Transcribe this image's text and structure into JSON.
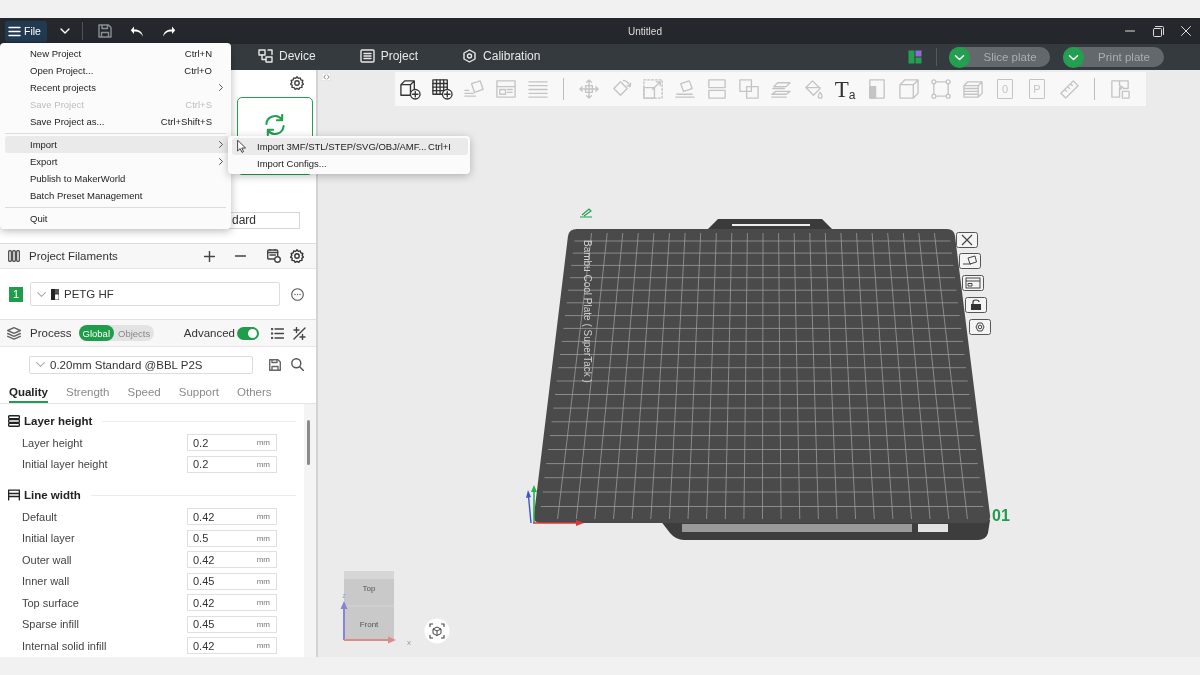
{
  "title_bar": {
    "file_button": {
      "label": "File",
      "active": true
    },
    "title": "Untitled"
  },
  "tabs": [
    {
      "label": "Device",
      "selected": false
    },
    {
      "label": "Project",
      "selected": false
    },
    {
      "label": "Calibration",
      "selected": false
    }
  ],
  "actions": [
    {
      "label": "Slice plate",
      "disabled": true
    },
    {
      "label": "Print plate",
      "disabled": true
    }
  ],
  "file_menu": {
    "groups": [
      {
        "items": [
          {
            "label": "New Project",
            "shortcut": "Ctrl+N",
            "disabled": false,
            "submenu": false,
            "selected": false
          },
          {
            "label": "Open Project...",
            "shortcut": "Ctrl+O",
            "disabled": false,
            "submenu": false,
            "selected": false
          },
          {
            "label": "Recent projects",
            "disabled": false,
            "submenu": true,
            "selected": false
          },
          {
            "label": "Save Project",
            "shortcut": "Ctrl+S",
            "disabled": true,
            "submenu": false,
            "selected": false
          },
          {
            "label": "Save Project as...",
            "shortcut": "Ctrl+Shift+S",
            "disabled": false,
            "submenu": false,
            "selected": false
          }
        ]
      },
      {
        "items": [
          {
            "label": "Import",
            "disabled": false,
            "submenu": true,
            "selected": true
          },
          {
            "label": "Export",
            "disabled": false,
            "submenu": true,
            "selected": false
          },
          {
            "label": "Publish to MakerWorld",
            "disabled": false,
            "submenu": false,
            "selected": false
          },
          {
            "label": "Batch Preset Management",
            "disabled": false,
            "submenu": false,
            "selected": false
          }
        ]
      },
      {
        "items": [
          {
            "label": "Quit",
            "disabled": false,
            "submenu": false,
            "selected": false
          }
        ]
      }
    ]
  },
  "import_submenu": {
    "items": [
      {
        "label": "Import 3MF/STL/STEP/SVG/OBJ/AMF...",
        "shortcut": "Ctrl+I",
        "selected": true
      },
      {
        "label": "Import Configs...",
        "selected": false
      }
    ]
  },
  "side_panel": {
    "printer": {
      "preset": "dard"
    },
    "filaments": {
      "title": "Project Filaments",
      "items": [
        {
          "number": "1",
          "name": "PETG HF",
          "color": "#1f9d4b"
        }
      ]
    },
    "process": {
      "title": "Process",
      "scope": [
        {
          "label": "Global",
          "selected": true
        },
        {
          "label": "Objects",
          "selected": false
        }
      ],
      "advanced": {
        "label": "Advanced",
        "on": true
      },
      "preset": "0.20mm Standard @BBL P2S",
      "tabs": [
        {
          "label": "Quality",
          "selected": true
        },
        {
          "label": "Strength",
          "selected": false
        },
        {
          "label": "Speed",
          "selected": false
        },
        {
          "label": "Support",
          "selected": false
        },
        {
          "label": "Others",
          "selected": false
        }
      ],
      "sections": [
        {
          "kind": "layers",
          "title": "Layer height",
          "rows": [
            {
              "label": "Layer height",
              "value": "0.2",
              "unit": "mm"
            },
            {
              "label": "Initial layer height",
              "value": "0.2",
              "unit": "mm"
            }
          ]
        },
        {
          "kind": "width",
          "title": "Line width",
          "rows": [
            {
              "label": "Default",
              "value": "0.42",
              "unit": "mm"
            },
            {
              "label": "Initial layer",
              "value": "0.5",
              "unit": "mm"
            },
            {
              "label": "Outer wall",
              "value": "0.42",
              "unit": "mm"
            },
            {
              "label": "Inner wall",
              "value": "0.45",
              "unit": "mm"
            },
            {
              "label": "Top surface",
              "value": "0.42",
              "unit": "mm"
            },
            {
              "label": "Sparse infill",
              "value": "0.45",
              "unit": "mm"
            },
            {
              "label": "Internal solid infill",
              "value": "0.42",
              "unit": "mm"
            }
          ]
        }
      ]
    }
  },
  "viewport": {
    "toolbar": {
      "groups": [
        {
          "tools": [
            {
              "kind": "icon",
              "disabled": false
            },
            {
              "kind": "icon",
              "disabled": false
            },
            {
              "kind": "icon",
              "disabled": true
            },
            {
              "kind": "icon",
              "disabled": true
            },
            {
              "kind": "icon",
              "disabled": true
            }
          ]
        },
        {
          "tools": [
            {
              "kind": "icon",
              "disabled": true
            },
            {
              "kind": "icon",
              "disabled": true
            },
            {
              "kind": "icon",
              "disabled": true
            },
            {
              "kind": "icon",
              "disabled": true
            },
            {
              "kind": "icon",
              "disabled": true
            },
            {
              "kind": "icon",
              "disabled": true
            },
            {
              "kind": "icon",
              "disabled": true
            },
            {
              "kind": "icon",
              "disabled": true
            },
            {
              "kind": "glyph",
              "glyph": "T$_{a}$",
              "disabled": false
            },
            {
              "kind": "icon",
              "disabled": true
            },
            {
              "kind": "icon",
              "disabled": true
            },
            {
              "kind": "icon",
              "disabled": true
            },
            {
              "kind": "icon",
              "disabled": true
            },
            {
              "kind": "page",
              "glyph": "0",
              "disabled": true
            },
            {
              "kind": "page",
              "glyph": "P",
              "disabled": true
            },
            {
              "kind": "icon",
              "disabled": true
            }
          ]
        },
        {
          "tools": [
            {
              "kind": "icon",
              "disabled": true
            }
          ]
        }
      ]
    },
    "plate": {
      "label": "Bambu Cool Plate ( SuperTack )",
      "number": "01"
    },
    "view_cube": {
      "faces": [
        "Top",
        "Front"
      ],
      "axes": [
        "z",
        "x"
      ]
    }
  }
}
